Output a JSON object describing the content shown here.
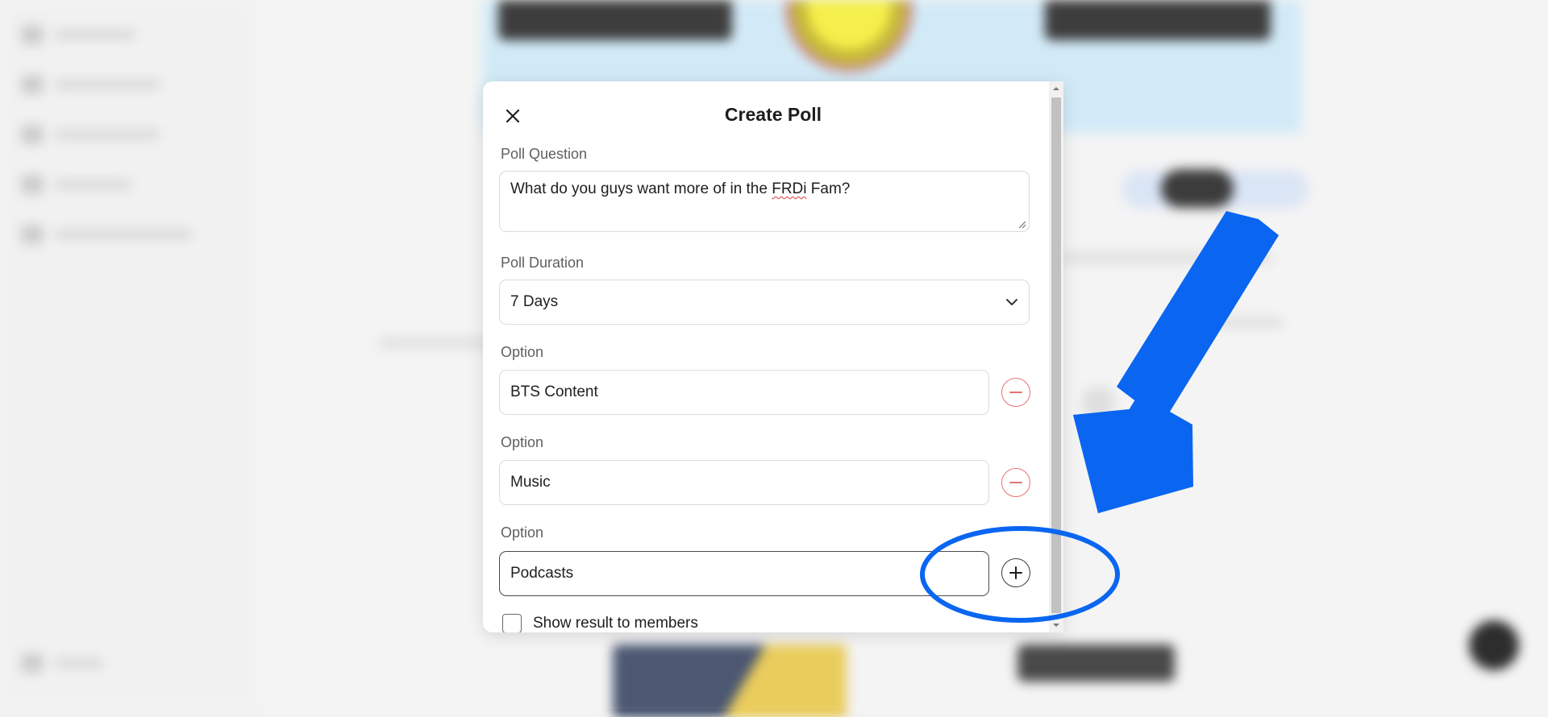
{
  "modal": {
    "title": "Create Poll",
    "close_icon": "close-icon",
    "question_label": "Poll Question",
    "question_value_before": "What do you guys want more of in the ",
    "question_value_flagged": "FRDi",
    "question_value_after": " Fam?",
    "duration_label": "Poll Duration",
    "duration_value": "7 Days",
    "options": [
      {
        "label": "Option",
        "value": "BTS Content",
        "action_icon": "remove-icon"
      },
      {
        "label": "Option",
        "value": "Music",
        "action_icon": "remove-icon"
      },
      {
        "label": "Option",
        "value": "Podcasts",
        "action_icon": "add-icon"
      }
    ],
    "show_results_label": "Show result to members",
    "show_results_checked": false
  },
  "colors": {
    "annotation_blue": "#0a66f0",
    "remove_red": "#e57373",
    "text_dark": "#1e1e1e"
  }
}
